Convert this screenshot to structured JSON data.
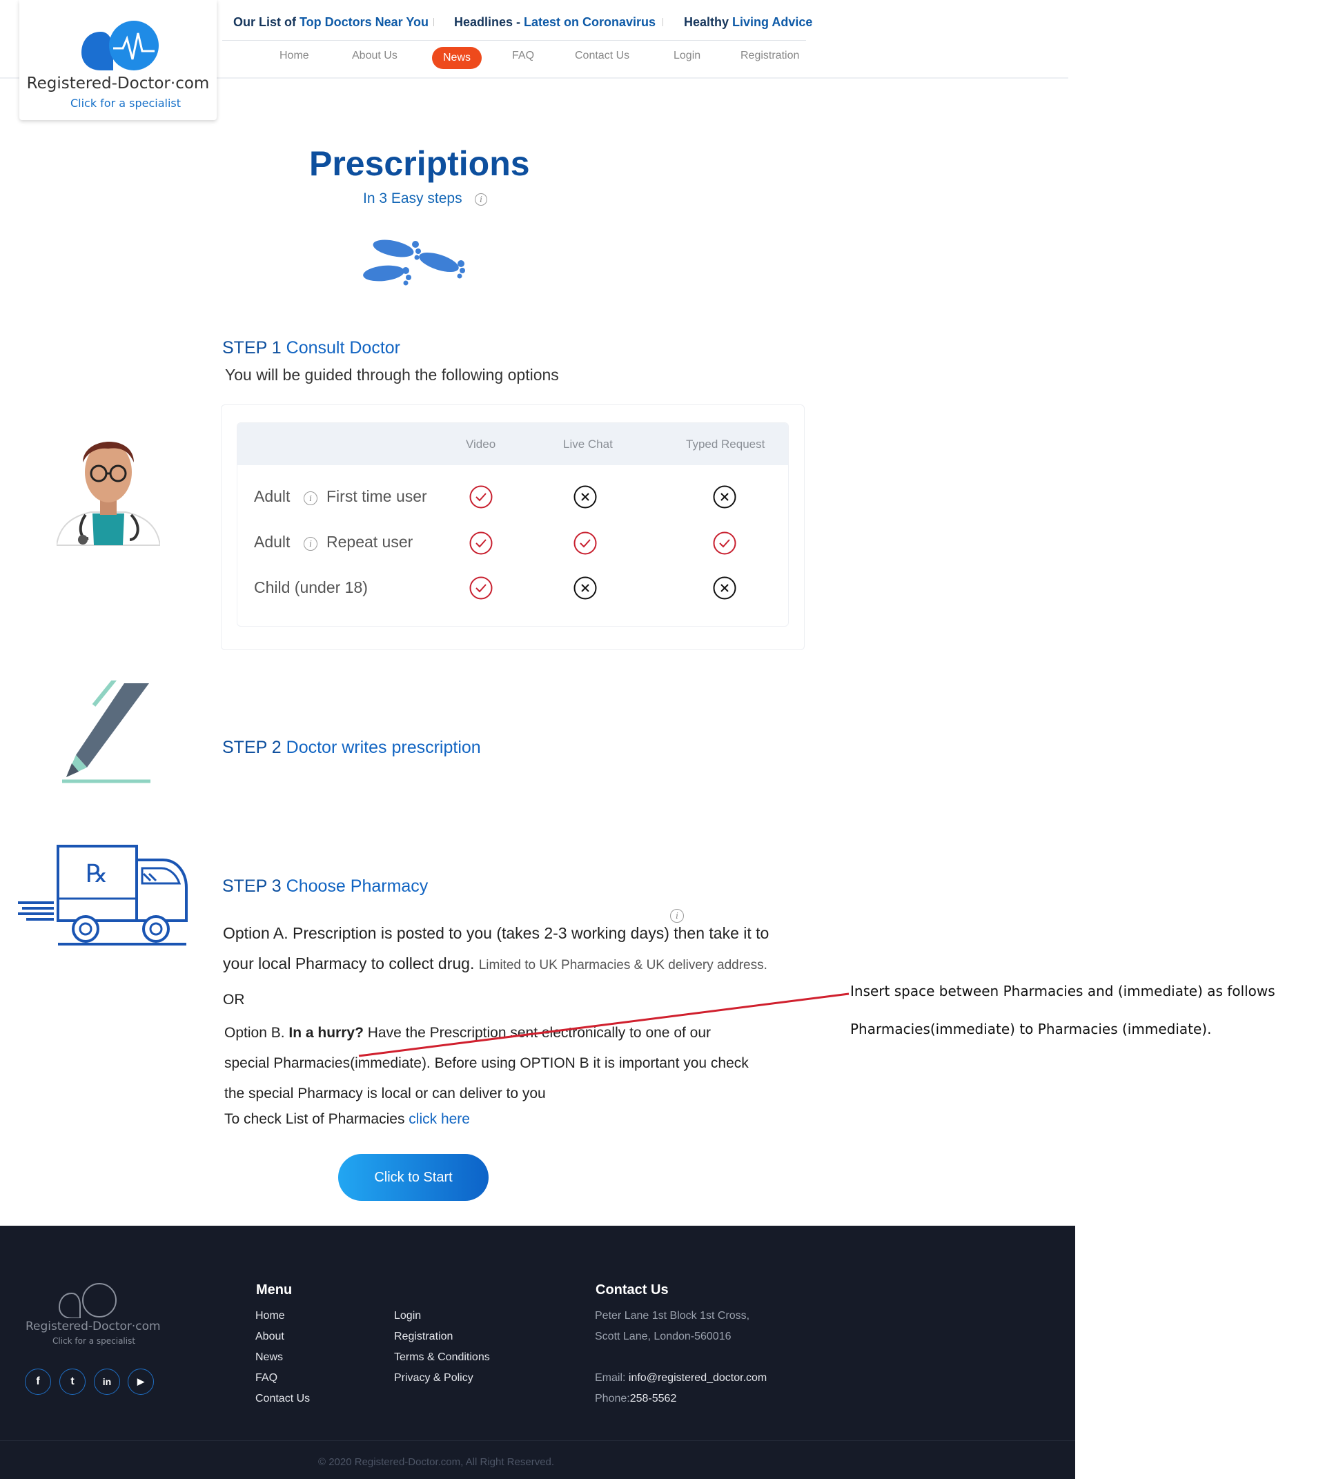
{
  "logo": {
    "name": "Registered-Doctor·com",
    "tagline": "Click for a specialist"
  },
  "topnav": {
    "item1_prefix": "Our List of ",
    "item1_link": "Top Doctors Near You",
    "item2_prefix": "Headlines - ",
    "item2_link": "Latest on Coronavirus",
    "item3_prefix": "Healthy ",
    "item3_link": "Living Advice"
  },
  "mainnav": [
    "Home",
    "About Us",
    "News",
    "FAQ",
    "Contact Us",
    "Login",
    "Registration"
  ],
  "hero": {
    "title": "Prescriptions",
    "subtitle": "In 3 Easy steps"
  },
  "step1": {
    "label": "STEP 1",
    "title": "Consult Doctor",
    "intro": "You will be guided through the following options",
    "columns": [
      "Video",
      "Live Chat",
      "Typed Request"
    ],
    "rows": [
      {
        "label": "Adult",
        "detail": "First time user",
        "video": "check",
        "live_chat": "cross",
        "typed": "cross"
      },
      {
        "label": "Adult",
        "detail": "Repeat user",
        "video": "check",
        "live_chat": "check",
        "typed": "check"
      },
      {
        "label": "Child (under 18)",
        "detail": "",
        "video": "check",
        "live_chat": "cross",
        "typed": "cross"
      }
    ]
  },
  "step2": {
    "label": "STEP 2",
    "title": "Doctor writes prescription"
  },
  "step3": {
    "label": "STEP 3",
    "title": "Choose Pharmacy",
    "optionA_line1": "Option A. Prescription is posted to you (takes 2-3 working days) then take it to",
    "optionA_line2": "your local Pharmacy to collect drug.",
    "optionA_note": "Limited to UK Pharmacies & UK delivery address.",
    "or": "OR",
    "optionB_prefix": "Option B. ",
    "optionB_bold": "In a hurry?",
    "optionB_line1": " Have the Prescription sent electronically to one of our",
    "optionB_line2": "special Pharmacies(immediate). Before using OPTION B it is important you check",
    "optionB_line3": "the special Pharmacy is local or can deliver to you",
    "check_list_prefix": "To check List of Pharmacies ",
    "check_list_link": "click here",
    "button": "Click to Start"
  },
  "annotation": {
    "line1": "Insert space between Pharmacies and (immediate) as follows",
    "line2": "Pharmacies(immediate) to Pharmacies (immediate).",
    "color": "#d0202e"
  },
  "footer": {
    "logo_name": "Registered-Doctor·com",
    "logo_tag": "Click for a specialist",
    "menu_title": "Menu",
    "menu_col1": [
      "Home",
      "About",
      "News",
      "FAQ",
      "Contact Us"
    ],
    "menu_col2": [
      "Login",
      "Registration",
      "Terms & Conditions",
      "Privacy & Policy"
    ],
    "contact_title": "Contact Us",
    "address_line1": "Peter Lane 1st Block 1st Cross,",
    "address_line2": "Scott Lane, London-560016",
    "email_label": "Email: ",
    "email": "info@registered_doctor.com",
    "phone_label": "Phone:",
    "phone": "258-5562",
    "copyright": "© 2020 Registered-Doctor.com, All Right Reserved."
  },
  "colors": {
    "brand_blue": "#0d4f9e",
    "accent_orange": "#ee4a1c",
    "check_red": "#c8202f",
    "footer_bg": "#161b28"
  }
}
